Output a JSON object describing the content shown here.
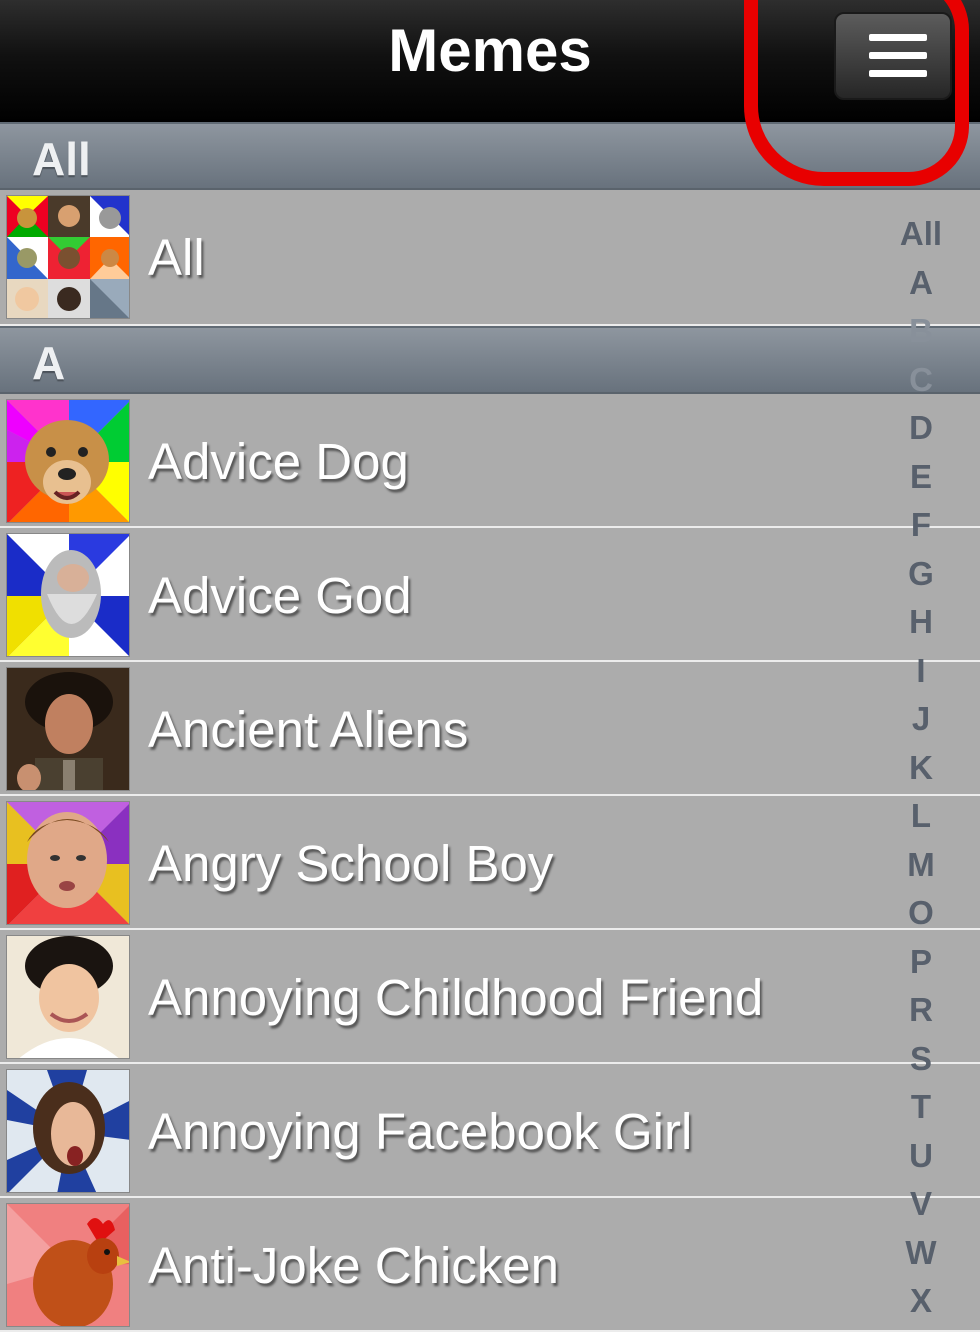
{
  "navbar": {
    "title": "Memes",
    "menu_icon": "hamburger-menu-icon"
  },
  "colors": {
    "highlight": "#e80000",
    "section_header": "#7b848e",
    "row_bg": "#acacac",
    "index_letter": "#58606c"
  },
  "sections": [
    {
      "header": "All",
      "rows": [
        {
          "label": "All",
          "thumb": "collage"
        }
      ]
    },
    {
      "header": "A",
      "rows": [
        {
          "label": "Advice Dog",
          "thumb": "dog"
        },
        {
          "label": "Advice God",
          "thumb": "god"
        },
        {
          "label": "Ancient Aliens",
          "thumb": "aliens"
        },
        {
          "label": "Angry School Boy",
          "thumb": "boy"
        },
        {
          "label": "Annoying Childhood Friend",
          "thumb": "friend"
        },
        {
          "label": "Annoying Facebook Girl",
          "thumb": "girl"
        },
        {
          "label": "Anti-Joke Chicken",
          "thumb": "chicken"
        }
      ]
    }
  ],
  "index": [
    "All",
    "A",
    "B",
    "C",
    "D",
    "E",
    "F",
    "G",
    "H",
    "I",
    "J",
    "K",
    "L",
    "M",
    "O",
    "P",
    "R",
    "S",
    "T",
    "U",
    "V",
    "W",
    "X"
  ]
}
